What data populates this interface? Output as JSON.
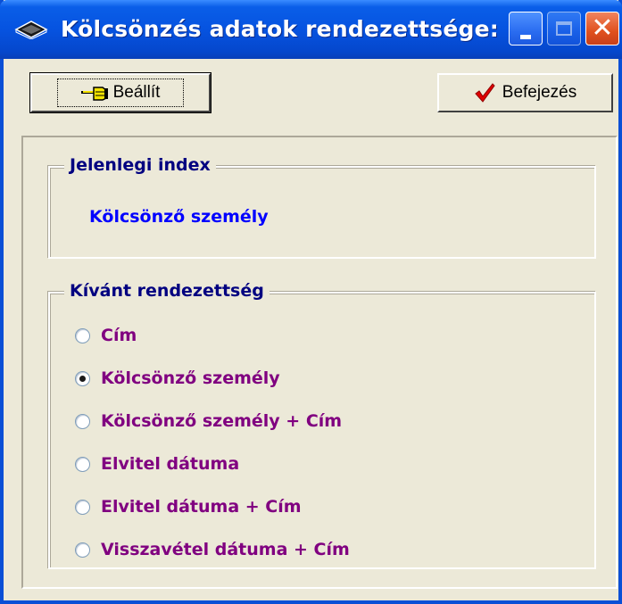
{
  "window": {
    "title": "Kölcsönzés adatok rendezettsége:"
  },
  "toolbar": {
    "set_label": "Beállít",
    "set_icon": "pointing-hand-icon",
    "finish_label": "Befejezés",
    "finish_icon": "red-checkmark-icon"
  },
  "current_index": {
    "legend": "Jelenlegi index",
    "value": "Kölcsönző személy"
  },
  "desired_order": {
    "legend": "Kívánt rendezettség",
    "options": [
      {
        "label": "Cím",
        "selected": false
      },
      {
        "label": "Kölcsönző személy",
        "selected": true
      },
      {
        "label": "Kölcsönző személy + Cím",
        "selected": false
      },
      {
        "label": "Elvitel dátuma",
        "selected": false
      },
      {
        "label": "Elvitel dátuma + Cím",
        "selected": false
      },
      {
        "label": "Visszavétel dátuma + Cím",
        "selected": false
      }
    ]
  },
  "colors": {
    "titlebar": "#0653e0",
    "legend": "#000080",
    "current_value": "#0000ff",
    "option_label": "#800080",
    "check": "#e00000"
  }
}
